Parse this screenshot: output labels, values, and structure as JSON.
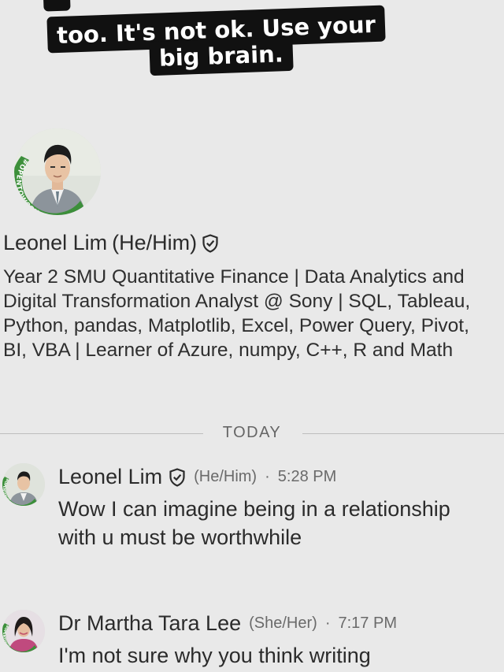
{
  "caption": {
    "line1": "too. It's not ok. Use your",
    "line2": "big brain."
  },
  "profile": {
    "name": "Leonel Lim",
    "pronouns": "(He/Him)",
    "badge_icon": "verified-shield-icon",
    "open_to_work": "#OPENTOWORK",
    "headline": "Year 2 SMU Quantitative Finance | Data Analytics and Digital Transformation Analyst @ Sony | SQL, Tableau, Python, pandas, Matplotlib, Excel, Power Query, Pivot, BI, VBA | Learner of Azure, numpy, C++, R and Math"
  },
  "divider": {
    "label": "TODAY"
  },
  "messages": [
    {
      "sender": "Leonel Lim",
      "verified": true,
      "pronouns": "(He/Him)",
      "separator": "·",
      "time": "5:28 PM",
      "text": "Wow I can imagine being in a relationship with u must be worthwhile",
      "open_to_work": "#OPENTOWORK"
    },
    {
      "sender": "Dr Martha Tara Lee",
      "verified": false,
      "pronouns": "(She/Her)",
      "separator": "·",
      "time": "7:17 PM",
      "text": "I'm not sure why you think writing",
      "open_to_work": "#OPENTOWORK"
    }
  ],
  "colors": {
    "background": "#e9e9e9",
    "open_to_work_green": "#3c8f3a",
    "caption_bg": "#111111"
  }
}
